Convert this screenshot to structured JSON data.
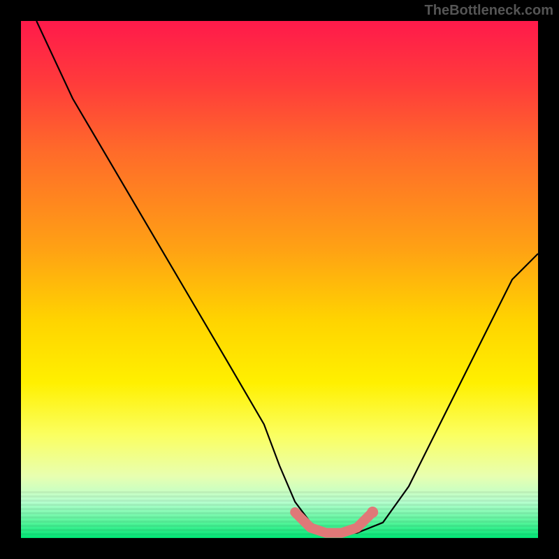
{
  "watermark": "TheBottleneck.com",
  "chart_data": {
    "type": "line",
    "title": "",
    "xlabel": "",
    "ylabel": "",
    "xlim": [
      0,
      100
    ],
    "ylim": [
      0,
      100
    ],
    "series": [
      {
        "name": "curve",
        "x": [
          3,
          10,
          20,
          30,
          40,
          47,
          50,
          53,
          56,
          59,
          62,
          65,
          70,
          75,
          80,
          85,
          90,
          95,
          100
        ],
        "values": [
          100,
          85,
          68,
          51,
          34,
          22,
          14,
          7,
          3,
          1,
          1,
          1,
          3,
          10,
          20,
          30,
          40,
          50,
          55
        ]
      },
      {
        "name": "highlight-band",
        "x": [
          53,
          56,
          59,
          62,
          65,
          68
        ],
        "values": [
          5,
          2,
          1,
          1,
          2,
          5
        ]
      }
    ],
    "annotations": []
  },
  "colors": {
    "curve": "#000000",
    "highlight": "#e07878",
    "background_top": "#ff1a4b",
    "background_bottom": "#00e676",
    "frame": "#000000"
  }
}
